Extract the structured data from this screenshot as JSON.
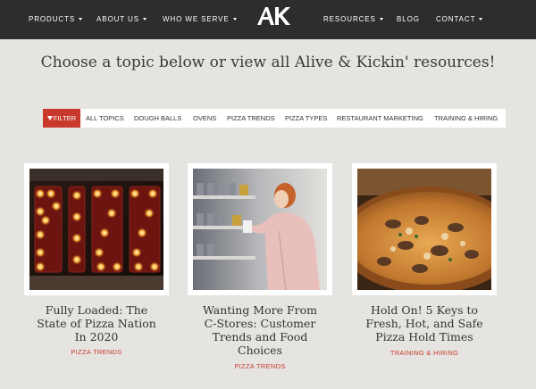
{
  "nav": {
    "left": [
      {
        "label": "PRODUCTS",
        "dropdown": true
      },
      {
        "label": "ABOUT US",
        "dropdown": true
      },
      {
        "label": "WHO WE SERVE",
        "dropdown": true
      }
    ],
    "logo_text": "AK",
    "right": [
      {
        "label": "RESOURCES",
        "dropdown": true
      },
      {
        "label": "BLOG",
        "dropdown": false
      },
      {
        "label": "CONTACT",
        "dropdown": true
      }
    ]
  },
  "headline": "Choose a topic below or view all Alive & Kickin' resources!",
  "filter": {
    "label": "FILTER",
    "topics": [
      "ALL TOPICS",
      "DOUGH BALLS",
      "OVENS",
      "PIZZA TRENDS",
      "PIZZA TYPES",
      "RESTAURANT MARKETING",
      "TRAINING & HIRING"
    ]
  },
  "cards": [
    {
      "title_lines": [
        "Fully Loaded: The",
        "State of Pizza Nation",
        "In 2020"
      ],
      "category": "PIZZA TRENDS",
      "image": "pizza-marquee-sign-photo"
    },
    {
      "title_lines": [
        "Wanting More From",
        "C-Stores: Customer",
        "Trends and Food",
        "Choices"
      ],
      "category": "PIZZA TRENDS",
      "image": "woman-shopping-store-photo"
    },
    {
      "title_lines": [
        "Hold On! 5 Keys to",
        "Fresh, Hot, and Safe",
        "Pizza Hold Times"
      ],
      "category": "TRAINING & HIRING",
      "image": "pizza-closeup-photo"
    }
  ],
  "colors": {
    "nav_bg": "#2b2d2e",
    "accent": "#c8392b",
    "page_bg": "#e6e4e1"
  }
}
